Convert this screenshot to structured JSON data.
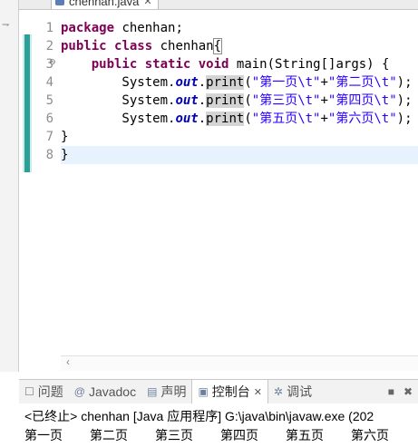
{
  "editor_tab": {
    "label": "chenhan.java",
    "close": "✕"
  },
  "gutter": [
    "1",
    "2",
    "3",
    "4",
    "5",
    "6",
    "7",
    "8"
  ],
  "code": {
    "l1": {
      "kw": "package",
      "rest": " chenhan;"
    },
    "l2": {
      "kw1": "public",
      "kw2": "class",
      "name": " chenhan",
      "brace": "{"
    },
    "l3": {
      "indent": "    ",
      "kw1": "public",
      "kw2": "static",
      "kw3": "void",
      "rest": " main(String[]args) {"
    },
    "l4": {
      "pre": "        System.",
      "field": "out",
      "dot": ".",
      "method": "print",
      "open": "(",
      "s1": "\"第一页\\t\"",
      "plus": "+",
      "s2": "\"第二页\\t\"",
      "end": ");"
    },
    "l5": {
      "pre": "        System.",
      "field": "out",
      "dot": ".",
      "method": "print",
      "open": "(",
      "s1": "\"第三页\\t\"",
      "plus": "+",
      "s2": "\"第四页\\t\"",
      "end": ");"
    },
    "l6": {
      "pre": "        System.",
      "field": "out",
      "dot": ".",
      "method": "print",
      "open": "(",
      "s1": "\"第五页\\t\"",
      "plus": "+",
      "s2": "\"第六页\\t\"",
      "end": ");"
    },
    "l7": "}",
    "l8": "}"
  },
  "panel": {
    "tabs": [
      {
        "label": "问题",
        "icon": "problems-icon"
      },
      {
        "label": "Javadoc",
        "icon": "at-icon"
      },
      {
        "label": "声明",
        "icon": "declaration-icon"
      },
      {
        "label": "控制台",
        "icon": "console-icon",
        "close": "✕"
      },
      {
        "label": "调试",
        "icon": "debug-icon"
      }
    ]
  },
  "console": {
    "status": "<已终止> chenhan [Java 应用程序] G:\\java\\bin\\javaw.exe  (202",
    "output": [
      "第一页",
      "第二页",
      "第三页",
      "第四页",
      "第五页",
      "第六页"
    ]
  },
  "colors": {
    "keyword": "#7f0055",
    "string": "#2a00ff",
    "field": "#0000c0",
    "line_highlight": "#e8f2fe"
  }
}
